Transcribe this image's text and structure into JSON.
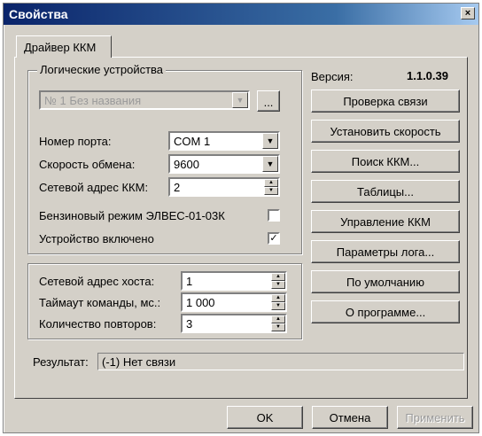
{
  "window": {
    "title": "Свойства",
    "close_glyph": "×"
  },
  "tabs": [
    {
      "label": "Драйвер ККМ"
    }
  ],
  "logical_devices": {
    "legend": "Логические устройства",
    "device_select": {
      "value": "№ 1 Без названия"
    },
    "browse_label": "...",
    "port": {
      "label": "Номер порта:",
      "value": "COM 1"
    },
    "speed": {
      "label": "Скорость обмена:",
      "value": "9600"
    },
    "net_address": {
      "label": "Сетевой адрес ККМ:",
      "value": "2"
    },
    "petrol_mode": {
      "label": "Бензиновый режим ЭЛВЕС-01-03К",
      "checked": false
    },
    "device_on": {
      "label": "Устройство включено",
      "checked": true,
      "check_glyph": "✓"
    }
  },
  "host": {
    "net_address": {
      "label": "Сетевой адрес хоста:",
      "value": "1"
    },
    "timeout": {
      "label": "Таймаут команды, мс.:",
      "value": "1 000"
    },
    "retries": {
      "label": "Количество повторов:",
      "value": "3"
    }
  },
  "version": {
    "label": "Версия:",
    "value": "1.1.0.39"
  },
  "side_buttons": {
    "check_connection": "Проверка связи",
    "set_speed": "Установить скорость",
    "search_kkm": "Поиск ККМ...",
    "tables": "Таблицы...",
    "manage_kkm": "Управление ККМ",
    "log_params": "Параметры лога...",
    "defaults": "По умолчанию",
    "about": "О программе..."
  },
  "result": {
    "label": "Результат:",
    "value": "(-1) Нет связи"
  },
  "footer": {
    "ok": "OK",
    "cancel": "Отмена",
    "apply": "Применить"
  },
  "colors": {
    "face": "#d4d0c8",
    "title_gradient_start": "#0a246a",
    "title_gradient_end": "#a6caf0"
  },
  "icons": {
    "dropdown": "chevron-down-icon",
    "spin_up": "spin-up-icon",
    "spin_down": "spin-down-icon",
    "close": "close-icon"
  }
}
